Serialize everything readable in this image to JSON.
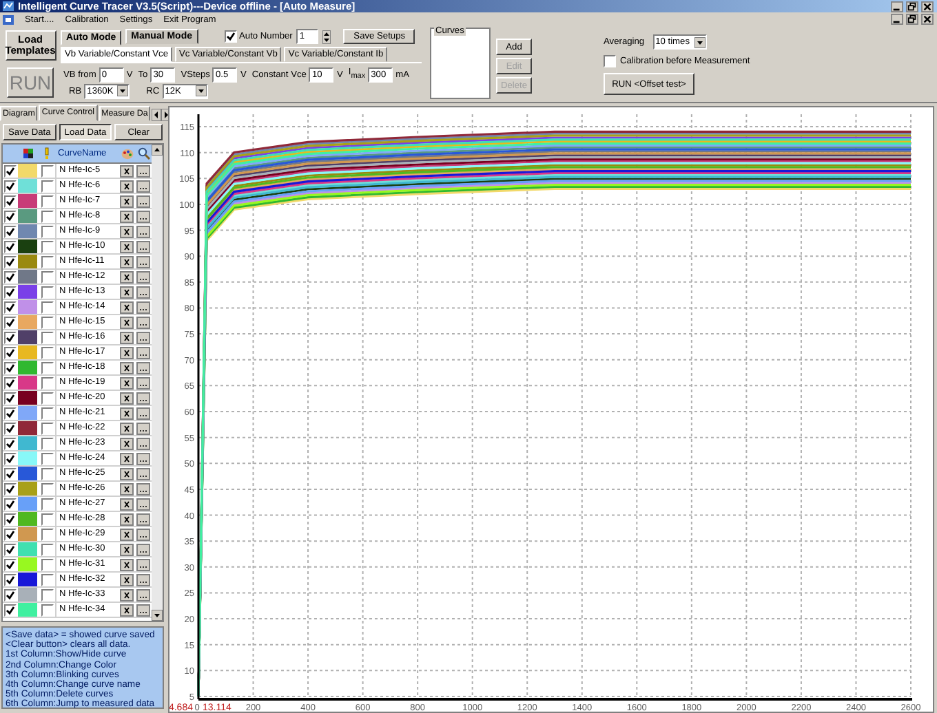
{
  "window": {
    "title": "Intelligent Curve Tracer V3.5(Script)---Device offline - [Auto Measure]"
  },
  "menu": [
    "Start....",
    "Calibration",
    "Settings",
    "Exit Program"
  ],
  "toolbar": {
    "load_templates": "Load Templates",
    "run": "RUN",
    "mode_tabs": [
      {
        "label": "Auto Mode",
        "selected": true
      },
      {
        "label": "Manual Mode",
        "selected": false
      }
    ],
    "auto_number": {
      "label": "Auto Number",
      "checked": true,
      "value": "1"
    },
    "save_setups": "Save Setups",
    "sub_tabs": [
      {
        "label": "Vb Variable/Constant Vce",
        "selected": true
      },
      {
        "label": "Vc Variable/Constant Vb",
        "selected": false
      },
      {
        "label": "Vc Variable/Constant Ib",
        "selected": false
      }
    ],
    "fields": [
      {
        "label": "VB from",
        "value": "0",
        "unit": "V"
      },
      {
        "label": "To",
        "value": "30"
      },
      {
        "label": "VSteps",
        "value": "0.5",
        "unit": "V"
      },
      {
        "label": "Constant Vce",
        "value": "10",
        "unit": "V"
      },
      {
        "label": "I$_{max}$",
        "value": "300",
        "unit": "mA"
      }
    ],
    "dropdowns": [
      {
        "label": "RB",
        "value": "1360K"
      },
      {
        "label": "RC",
        "value": "12K"
      }
    ],
    "curves": {
      "title": "Curves",
      "buttons": [
        {
          "label": "Add",
          "disabled": false
        },
        {
          "label": "Edit",
          "disabled": true
        },
        {
          "label": "Delete",
          "disabled": true
        }
      ]
    },
    "averaging": {
      "label": "Averaging",
      "value": "10 times"
    },
    "calibration": {
      "label": "Calibration before Measurement",
      "checked": false
    },
    "run_offset": "RUN <Offset test>"
  },
  "left_panel": {
    "tabs": [
      {
        "label": "Diagram",
        "selected": false
      },
      {
        "label": "Curve Control",
        "selected": true
      },
      {
        "label": "Measure Da",
        "selected": false
      }
    ],
    "buttons": [
      {
        "label": "Save Data",
        "pressed": false
      },
      {
        "label": "Load Data",
        "pressed": true
      },
      {
        "label": "Clear",
        "pressed": false
      }
    ],
    "header": "CurveName",
    "rows": [
      {
        "name": "N Hfe-Ic-5",
        "color": "#f2d96a",
        "visible": true,
        "blinking": false
      },
      {
        "name": "N Hfe-Ic-6",
        "color": "#6fe0d8",
        "visible": true,
        "blinking": false
      },
      {
        "name": "N Hfe-Ic-7",
        "color": "#c83c78",
        "visible": true,
        "blinking": false
      },
      {
        "name": "N Hfe-Ic-8",
        "color": "#5a9a80",
        "visible": true,
        "blinking": false
      },
      {
        "name": "N Hfe-Ic-9",
        "color": "#7088b0",
        "visible": true,
        "blinking": false
      },
      {
        "name": "N Hfe-Ic-10",
        "color": "#1a4010",
        "visible": true,
        "blinking": false
      },
      {
        "name": "N Hfe-Ic-11",
        "color": "#9a8a10",
        "visible": true,
        "blinking": false
      },
      {
        "name": "N Hfe-Ic-12",
        "color": "#707888",
        "visible": true,
        "blinking": false
      },
      {
        "name": "N Hfe-Ic-13",
        "color": "#7a40e8",
        "visible": true,
        "blinking": false
      },
      {
        "name": "N Hfe-Ic-14",
        "color": "#c090e8",
        "visible": true,
        "blinking": false
      },
      {
        "name": "N Hfe-Ic-15",
        "color": "#e8a860",
        "visible": true,
        "blinking": false
      },
      {
        "name": "N Hfe-Ic-16",
        "color": "#504068",
        "visible": true,
        "blinking": false
      },
      {
        "name": "N Hfe-Ic-17",
        "color": "#e8b820",
        "visible": true,
        "blinking": false
      },
      {
        "name": "N Hfe-Ic-18",
        "color": "#30b830",
        "visible": true,
        "blinking": false
      },
      {
        "name": "N Hfe-Ic-19",
        "color": "#d83888",
        "visible": true,
        "blinking": false
      },
      {
        "name": "N Hfe-Ic-20",
        "color": "#780020",
        "visible": true,
        "blinking": false
      },
      {
        "name": "N Hfe-Ic-21",
        "color": "#80a8f8",
        "visible": true,
        "blinking": false
      },
      {
        "name": "N Hfe-Ic-22",
        "color": "#902838",
        "visible": true,
        "blinking": false
      },
      {
        "name": "N Hfe-Ic-23",
        "color": "#40b8d0",
        "visible": true,
        "blinking": false
      },
      {
        "name": "N Hfe-Ic-24",
        "color": "#88f8f8",
        "visible": true,
        "blinking": false
      },
      {
        "name": "N Hfe-Ic-25",
        "color": "#2858d8",
        "visible": true,
        "blinking": false
      },
      {
        "name": "N Hfe-Ic-26",
        "color": "#a8a018",
        "visible": true,
        "blinking": false
      },
      {
        "name": "N Hfe-Ic-27",
        "color": "#68a0f8",
        "visible": true,
        "blinking": false
      },
      {
        "name": "N Hfe-Ic-28",
        "color": "#50b820",
        "visible": true,
        "blinking": false
      },
      {
        "name": "N Hfe-Ic-29",
        "color": "#d09850",
        "visible": true,
        "blinking": false
      },
      {
        "name": "N Hfe-Ic-30",
        "color": "#40e0b0",
        "visible": true,
        "blinking": false
      },
      {
        "name": "N Hfe-Ic-31",
        "color": "#98f820",
        "visible": true,
        "blinking": false
      },
      {
        "name": "N Hfe-Ic-32",
        "color": "#1818d8",
        "visible": true,
        "blinking": false
      },
      {
        "name": "N Hfe-Ic-33",
        "color": "#a8b0b8",
        "visible": true,
        "blinking": false
      },
      {
        "name": "N Hfe-Ic-34",
        "color": "#40f0a0",
        "visible": true,
        "blinking": false
      }
    ],
    "help": [
      "<Save data> = showed curve saved",
      "<Clear button> clears all data.",
      "1st Column:Show/Hide curve",
      "2nd Column:Change Color",
      "3th Column:Blinking curves",
      "4th Column:Change curve name",
      "5th Column:Delete curves",
      "6th Column:Jump to measured data"
    ]
  },
  "chart": {
    "min_y_label": "4.684",
    "min_x_label": "13.114",
    "y_labels": [
      "115",
      "110",
      "105",
      "100",
      "95",
      "90",
      "85",
      "80",
      "75",
      "70",
      "65",
      "60",
      "55",
      "50",
      "45",
      "40",
      "35",
      "30",
      "25",
      "20",
      "15",
      "10",
      "5"
    ],
    "x_labels": [
      "0",
      "200",
      "400",
      "600",
      "800",
      "1000",
      "1200",
      "1400",
      "1600",
      "1800",
      "2000",
      "2200",
      "2400",
      "2600"
    ]
  }
}
